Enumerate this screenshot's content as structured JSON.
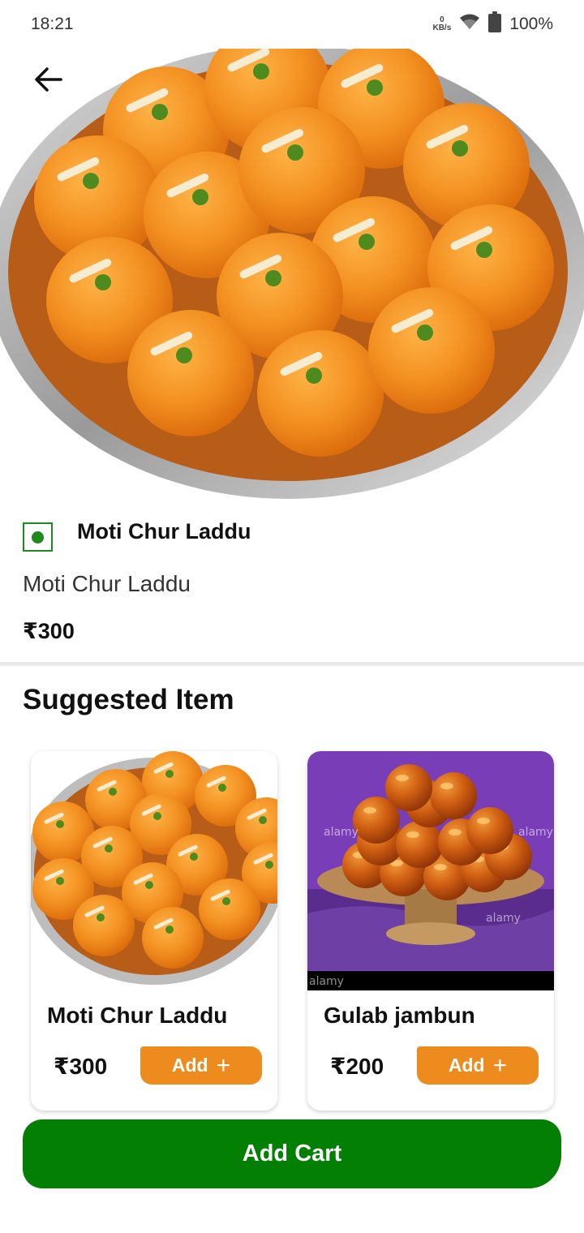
{
  "status_bar": {
    "time": "18:21",
    "net_speed_value": "0",
    "net_speed_unit": "KB/s",
    "battery": "100%"
  },
  "product": {
    "title": "Moti Chur Laddu",
    "description": "Moti Chur Laddu",
    "price": "₹300",
    "diet_type": "veg"
  },
  "suggested": {
    "title": "Suggested Item",
    "items": [
      {
        "name": "Moti Chur Laddu",
        "price": "₹300",
        "add_label": "Add"
      },
      {
        "name": "Gulab jambun",
        "price": "₹200",
        "add_label": "Add"
      }
    ]
  },
  "gulab_image_watermark": "alamy",
  "add_cart_label": "Add Cart",
  "colors": {
    "brand_green": "#038003",
    "veg_green": "#1c8a1c",
    "accent_orange": "#ee8b1e",
    "laddu_orange": "#f08a1a"
  },
  "icons": {
    "back": "arrow-left-icon",
    "wifi": "wifi-icon",
    "battery": "battery-icon",
    "plus": "plus-icon",
    "veg": "veg-indicator-icon"
  }
}
